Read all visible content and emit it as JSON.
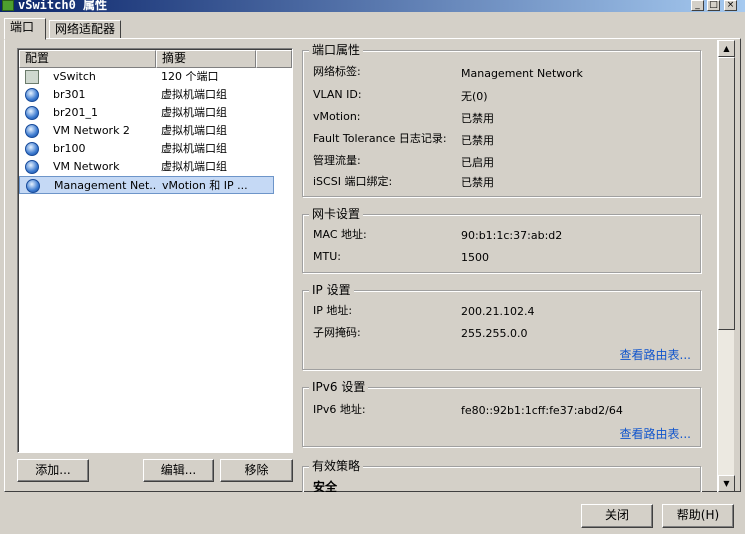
{
  "window": {
    "title": "vSwitch0 属性",
    "minimize": "_",
    "maximize": "□",
    "close": "×"
  },
  "tabs": [
    {
      "label": "端口"
    },
    {
      "label": "网络适配器"
    }
  ],
  "list": {
    "headers": [
      "配置",
      "摘要"
    ],
    "rows": [
      {
        "name": "vSwitch",
        "summary": "120 个端口",
        "icon": "switch-icon"
      },
      {
        "name": "br301",
        "summary": "虚拟机端口组",
        "icon": "globe-icon"
      },
      {
        "name": "br201_1",
        "summary": "虚拟机端口组",
        "icon": "globe-icon"
      },
      {
        "name": "VM Network 2",
        "summary": "虚拟机端口组",
        "icon": "globe-icon"
      },
      {
        "name": "br100",
        "summary": "虚拟机端口组",
        "icon": "globe-icon"
      },
      {
        "name": "VM Network",
        "summary": "虚拟机端口组",
        "icon": "globe-icon"
      },
      {
        "name": "Management Net...",
        "summary": "vMotion 和 IP ...",
        "icon": "globe-icon"
      }
    ]
  },
  "buttons": {
    "add": "添加...",
    "edit": "编辑...",
    "remove": "移除",
    "close": "关闭",
    "help": "帮助(H)"
  },
  "port_properties": {
    "title": "端口属性",
    "items": [
      {
        "label": "网络标签:",
        "value": "Management Network"
      },
      {
        "label": "VLAN ID:",
        "value": "无(0)"
      },
      {
        "label": "vMotion:",
        "value": "已禁用"
      },
      {
        "label": "Fault Tolerance 日志记录:",
        "value": "已禁用"
      },
      {
        "label": "管理流量:",
        "value": "已启用"
      },
      {
        "label": "iSCSI 端口绑定:",
        "value": "已禁用"
      }
    ]
  },
  "nic_settings": {
    "title": "网卡设置",
    "items": [
      {
        "label": "MAC 地址:",
        "value": "90:b1:1c:37:ab:d2"
      },
      {
        "label": "MTU:",
        "value": "1500"
      }
    ]
  },
  "ip_settings": {
    "title": "IP 设置",
    "items": [
      {
        "label": "IP 地址:",
        "value": "200.21.102.4"
      },
      {
        "label": "子网掩码:",
        "value": "255.255.0.0"
      }
    ],
    "link": "查看路由表..."
  },
  "ipv6_settings": {
    "title": "IPv6 设置",
    "items": [
      {
        "label": "IPv6 地址:",
        "value": "fe80::92b1:1cff:fe37:abd2/64"
      }
    ],
    "link": "查看路由表..."
  },
  "effective_policy": {
    "title": "有效策略",
    "first_item": "安全"
  },
  "scrollbar": {
    "up": "▲",
    "down": "▼"
  }
}
